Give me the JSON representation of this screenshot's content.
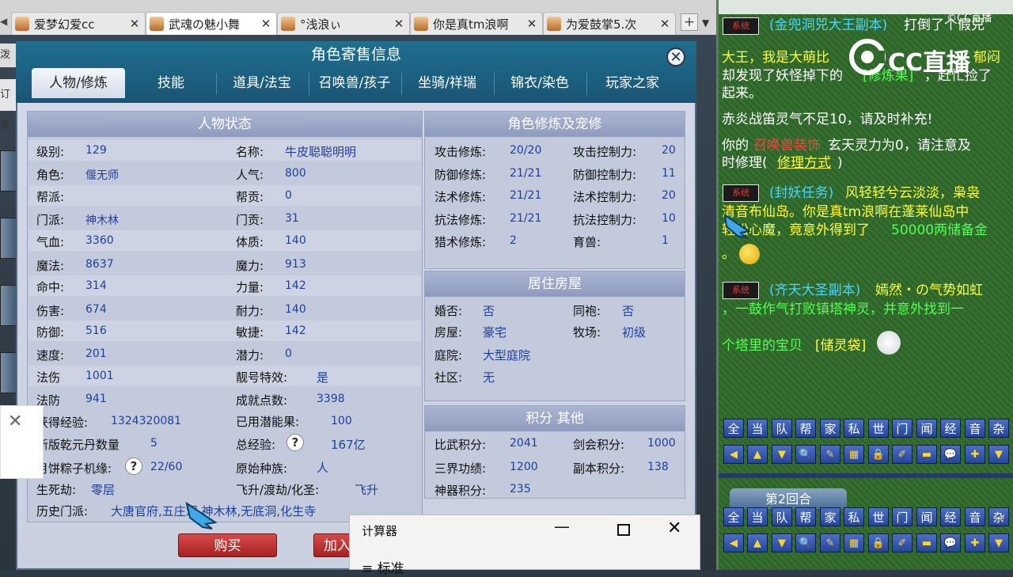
{
  "browser": {
    "tabs": [
      {
        "label": "爱梦幻爱cc",
        "active": false
      },
      {
        "label": "武魂の魅小舞",
        "active": true
      },
      {
        "label": "°浅浪ぃ",
        "active": false
      },
      {
        "label": "你是真tm浪啊",
        "active": false
      },
      {
        "label": "为爱鼓掌5.次",
        "active": false
      }
    ],
    "new_tab_symbol": "+",
    "close_symbol": "✕"
  },
  "left_edge": {
    "peek1": "泼",
    "peek2": "订单"
  },
  "dialog": {
    "title": "角色寄售信息",
    "close_symbol": "✕",
    "tabs": [
      "人物/修炼",
      "技能",
      "道具/法宝",
      "召唤兽/孩子",
      "坐骑/祥瑞",
      "锦衣/染色",
      "玩家之家"
    ],
    "status": {
      "header": "人物状态",
      "left": [
        {
          "label": "级别:",
          "value": "129"
        },
        {
          "label": "角色:",
          "value": "偃无师"
        },
        {
          "label": "帮派:",
          "value": ""
        },
        {
          "label": "门派:",
          "value": "神木林"
        },
        {
          "label": "气血:",
          "value": "3360"
        },
        {
          "label": "魔法:",
          "value": "8637"
        },
        {
          "label": "命中:",
          "value": "314"
        },
        {
          "label": "伤害:",
          "value": "674"
        },
        {
          "label": "防御:",
          "value": "516"
        },
        {
          "label": "速度:",
          "value": "201"
        },
        {
          "label": "法伤",
          "value": "1001"
        },
        {
          "label": "法防",
          "value": "941"
        }
      ],
      "right": [
        {
          "label": "名称:",
          "value": "牛皮聪聪明明"
        },
        {
          "label": "人气:",
          "value": "800"
        },
        {
          "label": "帮贡:",
          "value": "0"
        },
        {
          "label": "门贡:",
          "value": "31"
        },
        {
          "label": "体质:",
          "value": "140"
        },
        {
          "label": "魔力:",
          "value": "913"
        },
        {
          "label": "力量:",
          "value": "142"
        },
        {
          "label": "耐力:",
          "value": "140"
        },
        {
          "label": "敏捷:",
          "value": "142"
        },
        {
          "label": "潜力:",
          "value": "0"
        },
        {
          "label": "靓号特效:",
          "value": "是"
        },
        {
          "label": "成就点数:",
          "value": "3398"
        }
      ],
      "extra": [
        {
          "label": "获得经验:",
          "value": "1324320081"
        },
        {
          "label": "已用潜能果:",
          "value": "100"
        },
        {
          "label": "新版乾元丹数量",
          "value": "5"
        },
        {
          "label": "总经验:",
          "value": "167亿"
        },
        {
          "label": "月饼粽子机缘:",
          "value": "22/60"
        },
        {
          "label": "原始种族:",
          "value": "人"
        },
        {
          "label": "生死劫:",
          "value": "零层"
        },
        {
          "label": "飞升/渡劫/化圣:",
          "value": "飞升"
        },
        {
          "label": "历史门派:",
          "value": "大唐官府,五庄观,神木林,无底洞,化生寺"
        }
      ],
      "help_symbol": "?"
    },
    "cultivation": {
      "header": "角色修炼及宠修",
      "rows": [
        {
          "l1": "攻击修炼:",
          "v1": "20/20",
          "l2": "攻击控制力:",
          "v2": "20"
        },
        {
          "l1": "防御修炼:",
          "v1": "21/21",
          "l2": "防御控制力:",
          "v2": "11"
        },
        {
          "l1": "法术修炼:",
          "v1": "21/21",
          "l2": "法术控制力:",
          "v2": "20"
        },
        {
          "l1": "抗法修炼:",
          "v1": "21/21",
          "l2": "抗法控制力:",
          "v2": "10"
        },
        {
          "l1": "猎术修炼:",
          "v1": "2",
          "l2": "育兽:",
          "v2": "1"
        }
      ]
    },
    "housing": {
      "header": "居住房屋",
      "rows": [
        {
          "l1": "婚否:",
          "v1": "否",
          "l2": "同袍:",
          "v2": "否"
        },
        {
          "l1": "房屋:",
          "v1": "豪宅",
          "l2": "牧场:",
          "v2": "初级"
        },
        {
          "l1": "庭院:",
          "v1": "大型庭院",
          "l2": "",
          "v2": ""
        },
        {
          "l1": "社区:",
          "v1": "无",
          "l2": "",
          "v2": ""
        }
      ]
    },
    "points": {
      "header": "积分 其他",
      "rows": [
        {
          "l1": "比武积分:",
          "v1": "2041",
          "l2": "剑会积分:",
          "v2": "1000"
        },
        {
          "l1": "三界功绩:",
          "v1": "1200",
          "l2": "副本积分:",
          "v2": "138"
        },
        {
          "l1": "神器积分:",
          "v1": "235",
          "l2": "",
          "v2": ""
        }
      ]
    },
    "buy_label": "购买",
    "add_label": "加入"
  },
  "popup_close": "✕",
  "calculator": {
    "title": "计算器",
    "minimize": "—",
    "close": "✕",
    "mode": "≡  标准"
  },
  "chat": {
    "watermark_corner": "©CC直播",
    "logo_text": "CC直播",
    "badge": "系统",
    "messages": {
      "m1a": "(金兜洞兕大王副本)",
      "m1b": "打倒了个假兕",
      "m1c": "大王，我是大萌比",
      "m1d": "郁闷",
      "m1e": "却发现了妖怪掉下的",
      "m1f": "[修炼果]",
      "m1g": "，赶忙捡了",
      "m1h": "起来。",
      "m2": "赤炎战笛灵气不足10，请及时补充!",
      "m3a": "你的",
      "m3b": "召唤兽装饰",
      "m3c": "玄天灵力为0，请注意及",
      "m3d": "时修理(",
      "m3e": "修理方式",
      "m3f": ")",
      "m4a": "(封妖任务)",
      "m4b": "风轻轻兮云淡淡，枭袅",
      "m4c": "清音布仙岛。你是真tm浪啊在蓬莱仙岛中",
      "m4d": "轻松心魔，竟意外得到了",
      "m4e": "50000两储备金",
      "m4f": "。",
      "m5a": "(齐天大圣副本)",
      "m5b": "嫣然・の气势如虹",
      "m5c": "，一鼓作气打败镇塔神灵，并意外找到一",
      "m5d": "个塔里的宝贝",
      "m5e": "[储灵袋]"
    },
    "channels": [
      "全",
      "当",
      "队",
      "帮",
      "家",
      "私",
      "世",
      "门",
      "闻",
      "经",
      "音",
      "杂"
    ],
    "tools": [
      "◀",
      "▲",
      "▼",
      "🔍",
      "✎",
      "▦",
      "🔒",
      "✐",
      "▬",
      "💬",
      "✚",
      "▼"
    ],
    "round_label": "第2回合"
  }
}
